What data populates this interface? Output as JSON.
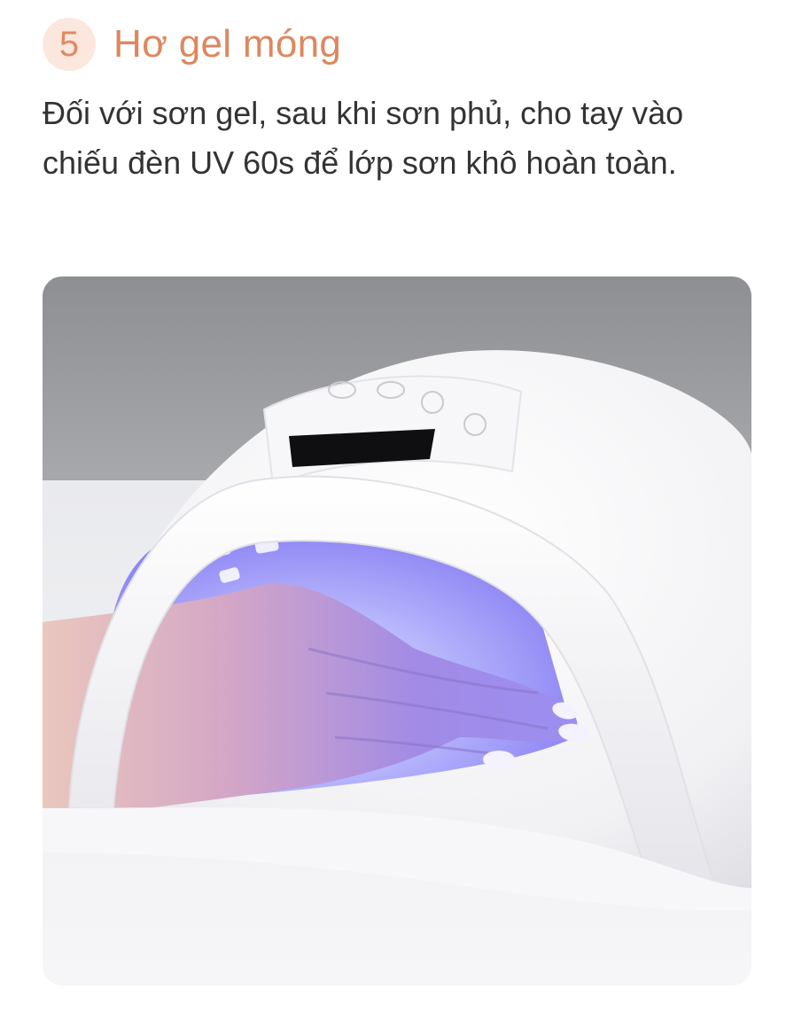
{
  "step": {
    "number": "5",
    "title": "Hơ gel móng",
    "description": "Đối với sơn gel, sau khi sơn phủ, cho tay vào chiếu đèn UV 60s để lớp sơn khô hoàn toàn."
  },
  "photo": {
    "subject": "hand-under-uv-nail-lamp"
  },
  "colors": {
    "accent": "#de875f",
    "badge_bg": "#fbe7dd",
    "text": "#333333",
    "uv_glow": "#8a7cf5"
  }
}
